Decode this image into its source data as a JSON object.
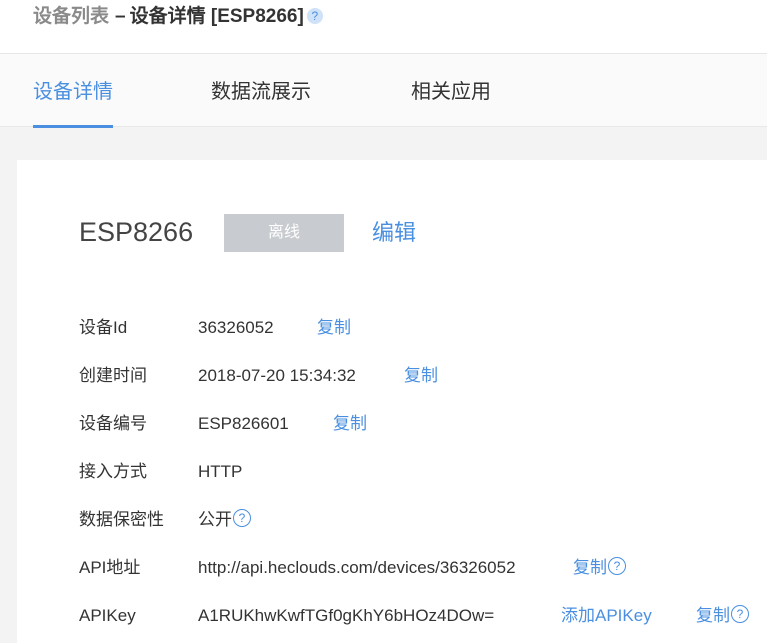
{
  "breadcrumb": {
    "parent": "设备列表",
    "separator": "–",
    "current": "设备详情 [ESP8266]",
    "help": "?"
  },
  "tabs": [
    {
      "label": "设备详情",
      "active": true
    },
    {
      "label": "数据流展示",
      "active": false
    },
    {
      "label": "相关应用",
      "active": false
    }
  ],
  "device": {
    "name": "ESP8266",
    "status": "离线",
    "edit_label": "编辑"
  },
  "details": {
    "device_id": {
      "label": "设备Id",
      "value": "36326052",
      "action": "复制"
    },
    "created": {
      "label": "创建时间",
      "value": "2018-07-20 15:34:32",
      "action": "复制"
    },
    "device_code": {
      "label": "设备编号",
      "value": "ESP826601",
      "action": "复制"
    },
    "protocol": {
      "label": "接入方式",
      "value": "HTTP"
    },
    "privacy": {
      "label": "数据保密性",
      "value": "公开",
      "help": "?"
    },
    "api_address": {
      "label": "API地址",
      "value": "http://api.heclouds.com/devices/36326052",
      "action": "复制",
      "help": "?"
    },
    "api_key": {
      "label": "APIKey",
      "value": "A1RUKhwKwfTGf0gKhY6bHOz4DOw=",
      "add_action": "添加APIKey",
      "action": "复制",
      "help": "?"
    }
  },
  "colors": {
    "accent": "#4a8fe0",
    "status_badge": "#c8cbcf"
  }
}
